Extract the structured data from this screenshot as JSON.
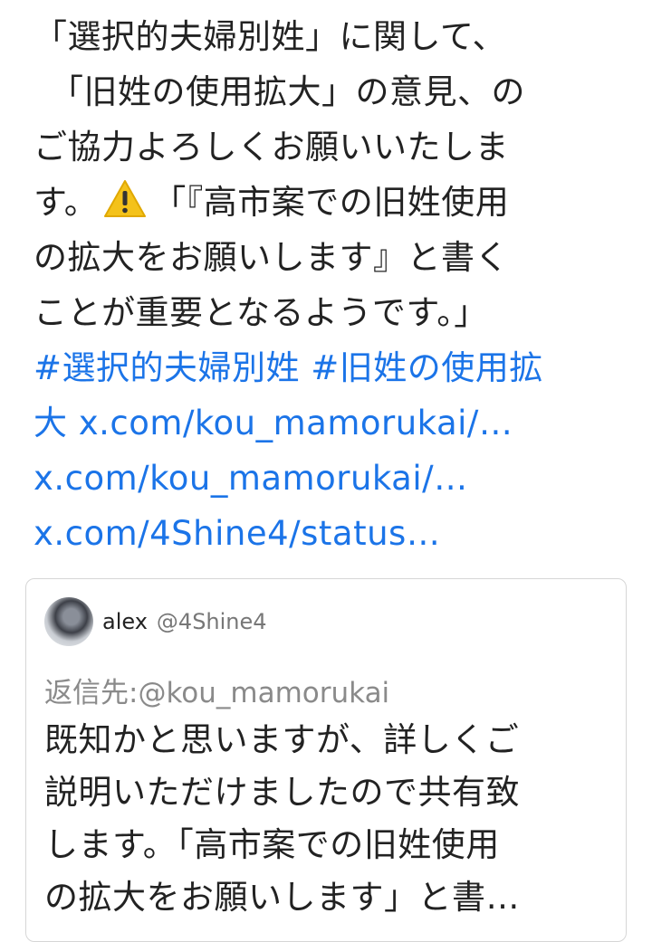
{
  "tweet": {
    "lines": [
      "「選択的夫婦別姓」に関して、",
      "「旧姓の使用拡大」の意見、の",
      "ご協力よろしくお願いいたしま",
      "す。",
      "「『高市案での旧姓使用",
      "の拡大をお願いします』と書く",
      "ことが重要となるようです。」"
    ],
    "hashtag_1": "#選択的夫婦別姓",
    "hashtag_2a": "#旧姓の使用拡",
    "hashtag_2b": "大",
    "link_1": "x.com/kou_mamorukai/…",
    "link_2": "x.com/kou_mamorukai/…",
    "link_3": "x.com/4Shine4/status…"
  },
  "quoted": {
    "name": "alex",
    "handle": "@4Shine4",
    "reply_to": "返信先:@kou_mamorukai",
    "lines": [
      "既知かと思いますが、詳しくご",
      "説明いただけましたので共有致",
      "します。「高市案での旧姓使用",
      "の拡大をお願いします」と書…"
    ]
  },
  "colors": {
    "link": "#1b74e8",
    "text": "#222222",
    "muted": "#8a8a8a",
    "warning": "#f4c21a"
  },
  "icons": {
    "warning": "warning-icon"
  }
}
